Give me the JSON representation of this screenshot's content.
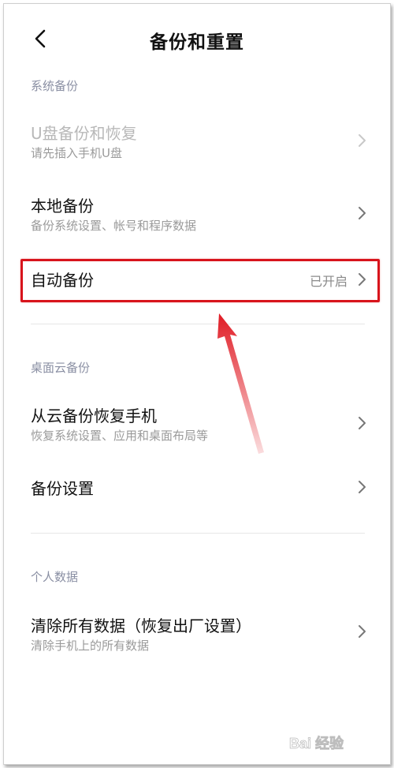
{
  "header": {
    "title": "备份和重置"
  },
  "sections": [
    {
      "label": "系统备份",
      "items": [
        {
          "title": "U盘备份和恢复",
          "subtitle": "请先插入手机U盘",
          "disabled": true
        },
        {
          "title": "本地备份",
          "subtitle": "备份系统设置、帐号和程序数据"
        },
        {
          "title": "自动备份",
          "status": "已开启"
        }
      ]
    },
    {
      "label": "桌面云备份",
      "items": [
        {
          "title": "从云备份恢复手机",
          "subtitle": "恢复系统设置、应用和桌面布局等"
        },
        {
          "title": "备份设置"
        }
      ]
    },
    {
      "label": "个人数据",
      "items": [
        {
          "title": "清除所有数据（恢复出厂设置）",
          "subtitle": "清除手机上的所有数据"
        }
      ]
    }
  ],
  "watermark": {
    "text": "Bai 经验",
    "logo": "baidu-paw-logo"
  },
  "colors": {
    "highlight": "#d8141c",
    "section_label": "#8a8fa3",
    "subtitle": "#9a9a9a",
    "disabled": "#b8b8b8"
  }
}
